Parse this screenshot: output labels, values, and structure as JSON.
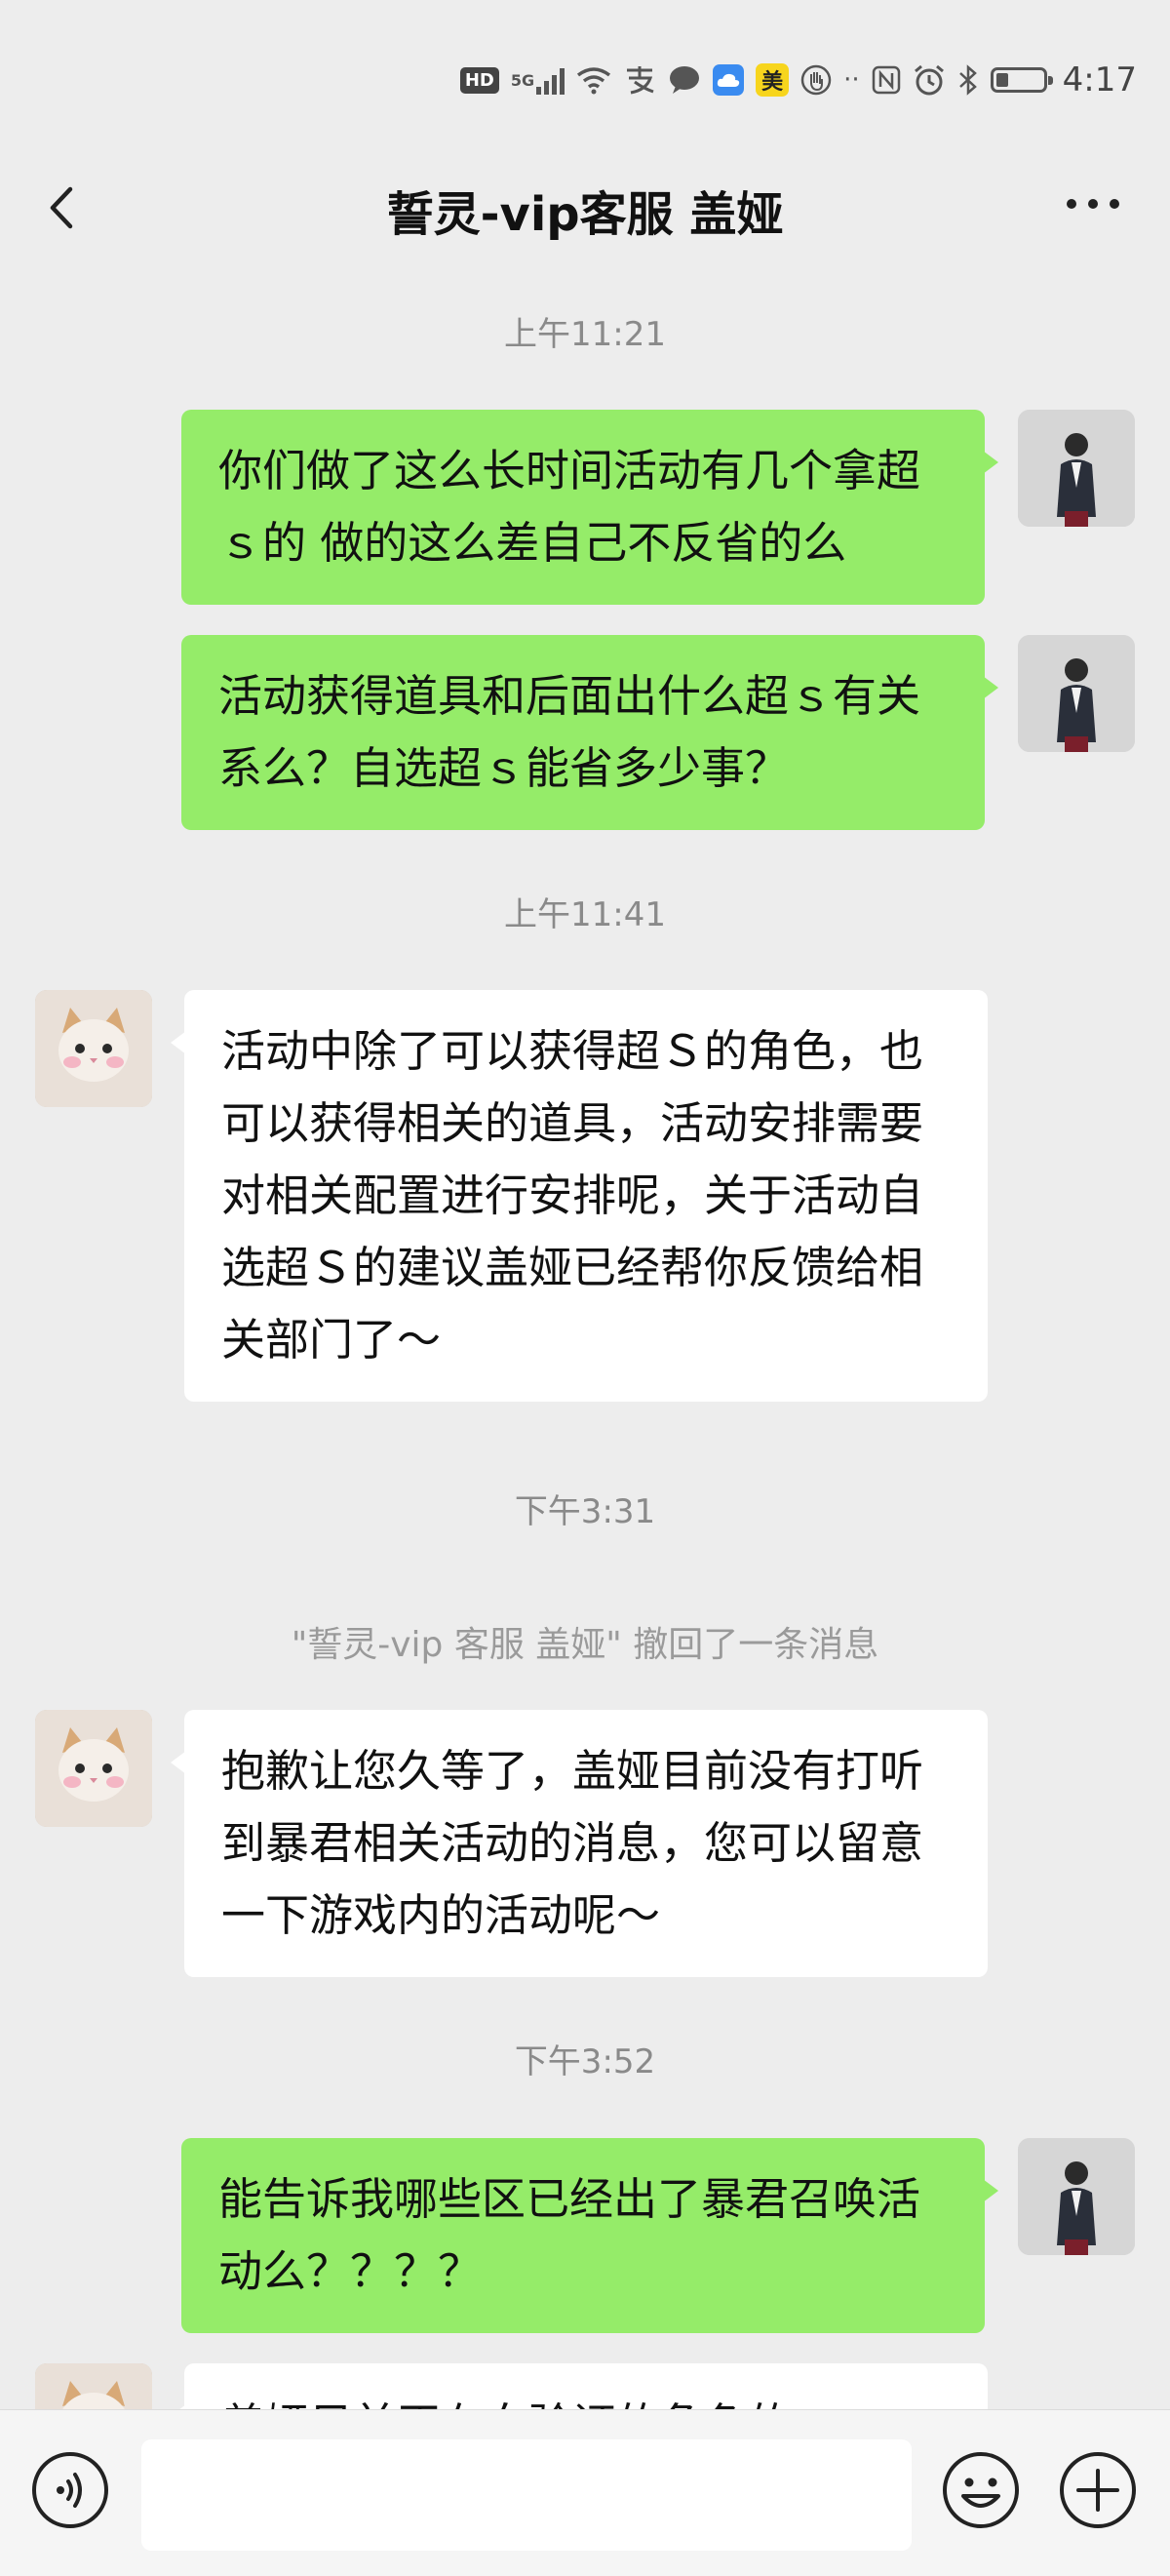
{
  "status_bar": {
    "hd": "HD",
    "network": "5G",
    "time": "4:17",
    "shopping_app_glyph": "美",
    "icons": [
      "hd-icon",
      "signal-5g-icon",
      "wifi-icon",
      "alipay-icon",
      "message-icon",
      "cloud-app-icon",
      "meituan-icon",
      "hand-icon",
      "nfc-icon",
      "alarm-icon",
      "bluetooth-icon",
      "battery-icon"
    ]
  },
  "header": {
    "title": "誓灵-vip客服 盖娅",
    "back_icon": "chevron-left-icon",
    "more_icon": "more-dots-icon"
  },
  "chat": {
    "messages": [
      {
        "kind": "timestamp",
        "text": "上午11:21"
      },
      {
        "kind": "outgoing",
        "text": "你们做了这么长时间活动有几个拿超ｓ的 做的这么差自己不反省的么"
      },
      {
        "kind": "outgoing",
        "text": "活动获得道具和后面出什么超ｓ有关系么？自选超ｓ能省多少事？"
      },
      {
        "kind": "timestamp",
        "text": "上午11:41"
      },
      {
        "kind": "incoming",
        "text": "活动中除了可以获得超Ｓ的角色，也可以获得相关的道具，活动安排需要对相关配置进行安排呢，关于活动自选超Ｓ的建议盖娅已经帮你反馈给相关部门了～"
      },
      {
        "kind": "timestamp",
        "text": "下午3:31"
      },
      {
        "kind": "system",
        "text": "\"誓灵-vip 客服 盖娅\" 撤回了一条消息"
      },
      {
        "kind": "incoming",
        "text": "抱歉让您久等了，盖娅目前没有打听到暴君相关活动的消息，您可以留意一下游戏内的活动呢～"
      },
      {
        "kind": "timestamp",
        "text": "下午3:52"
      },
      {
        "kind": "outgoing",
        "text": "能告诉我哪些区已经出了暴君召唤活动么？？？？"
      },
      {
        "kind": "incoming",
        "text": "盖娅目前正在向验证的角色的"
      }
    ]
  },
  "input_bar": {
    "voice_icon": "voice-icon",
    "emoji_icon": "emoji-icon",
    "plus_icon": "plus-icon",
    "input_value": ""
  },
  "colors": {
    "background": "#ededed",
    "outgoing_bubble": "#95ec69",
    "incoming_bubble": "#ffffff",
    "timestamp_text": "#8a8a8a"
  }
}
